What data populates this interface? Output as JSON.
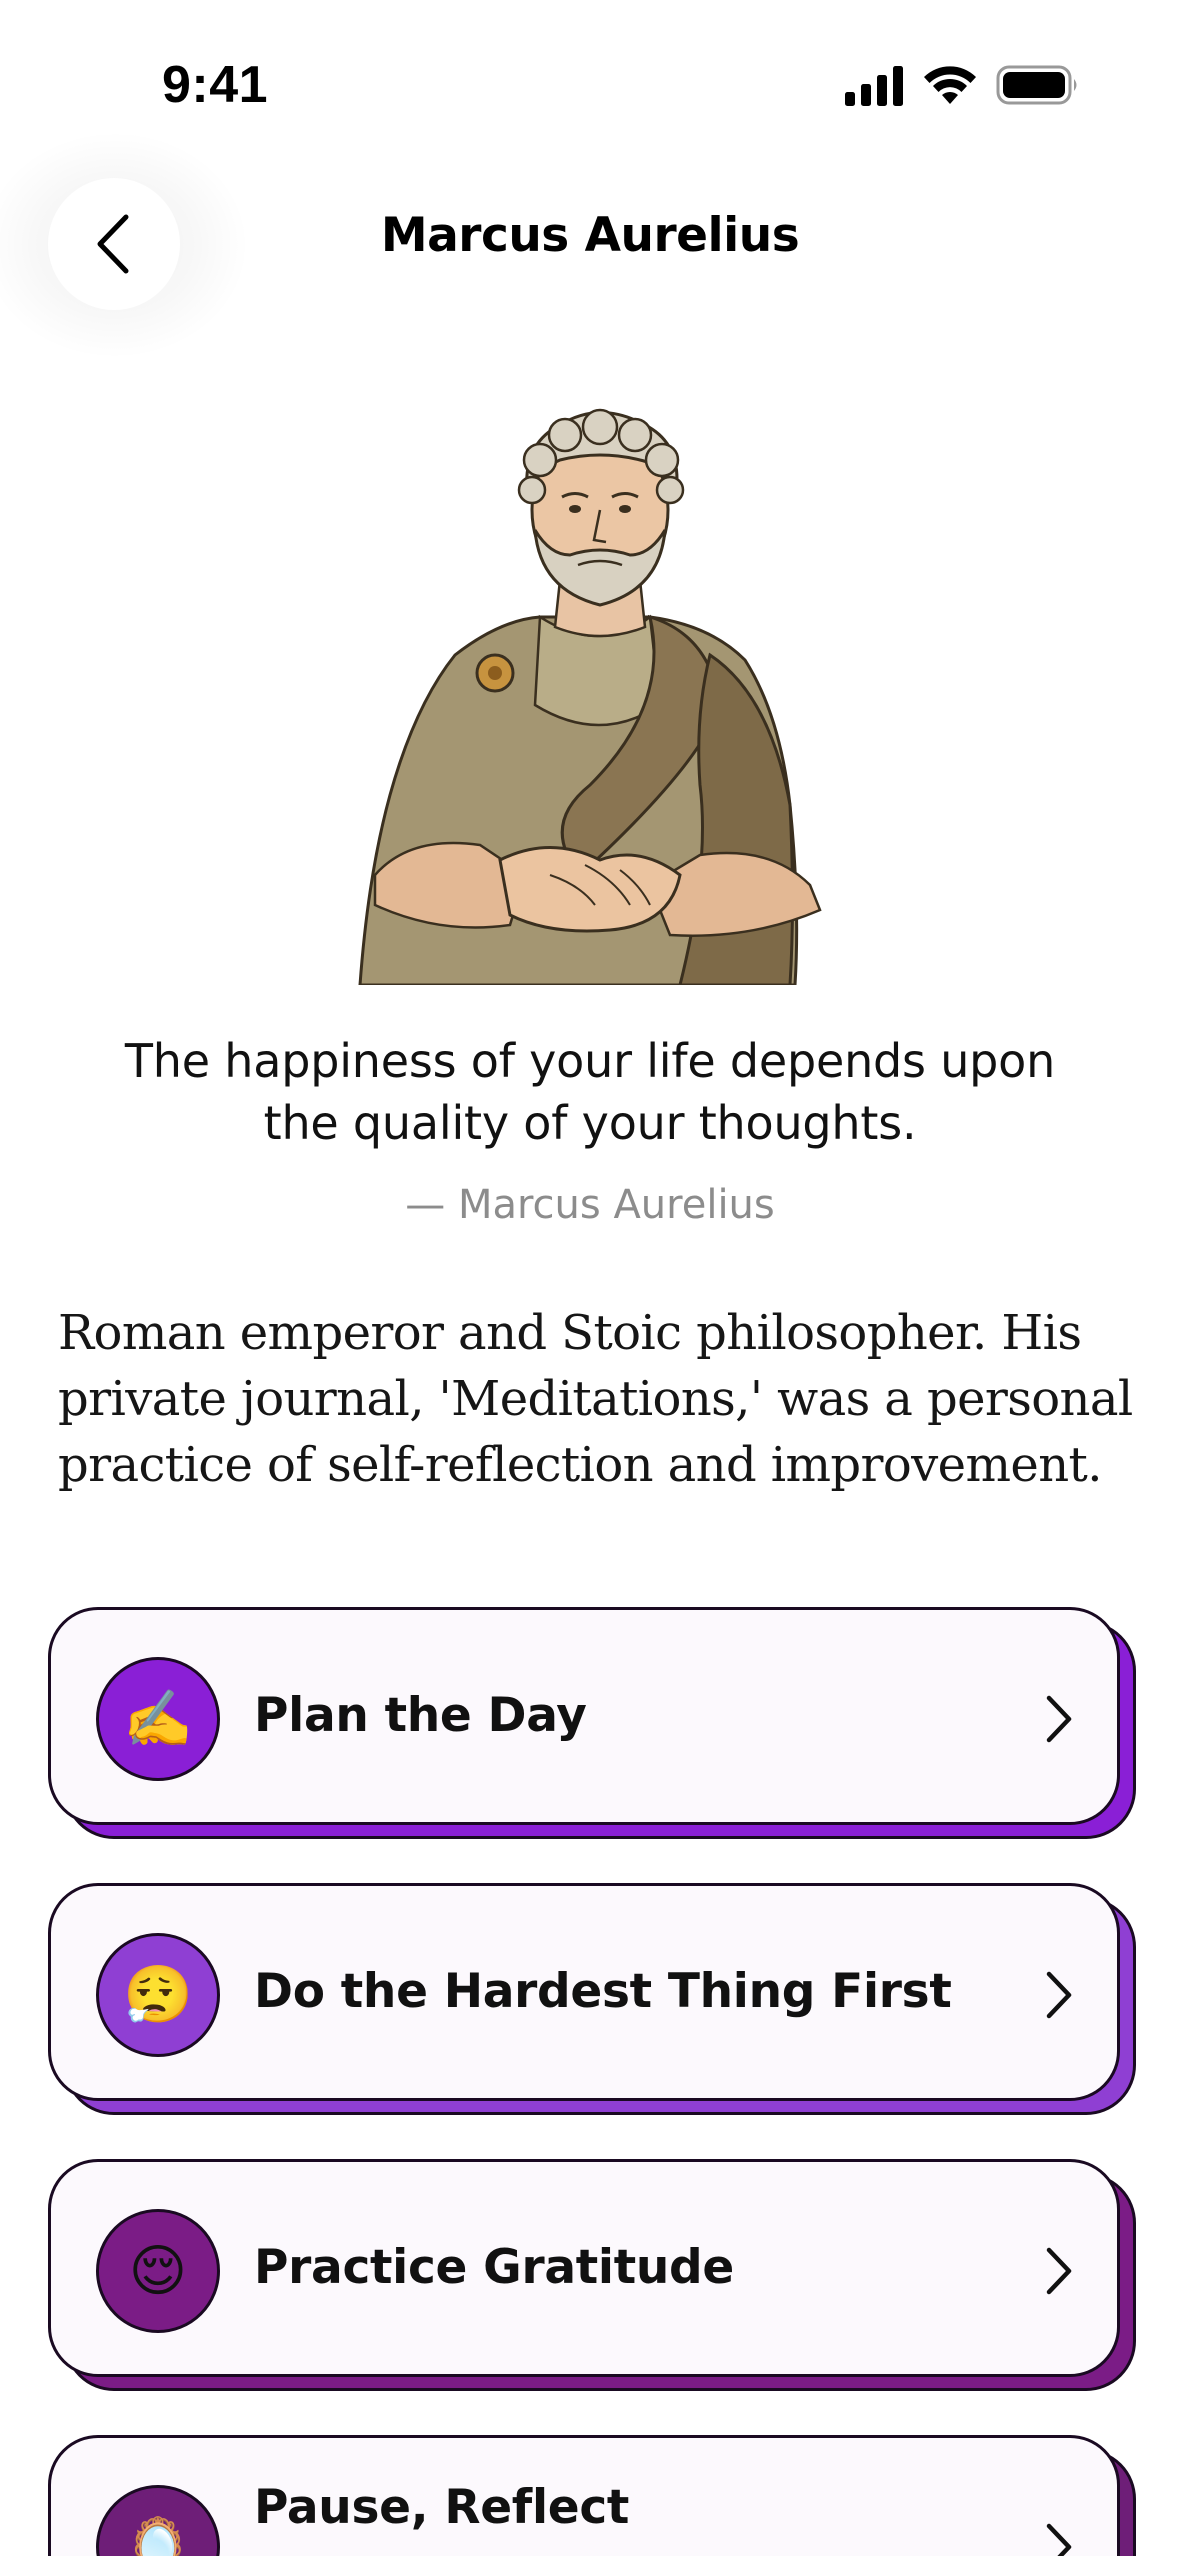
{
  "status_bar": {
    "time": "9:41"
  },
  "header": {
    "title": "Marcus Aurelius",
    "back_icon": "chevron-left-icon"
  },
  "portrait": {
    "subject": "marcus-aurelius-illustration"
  },
  "quote": {
    "text": "The happiness of your life depends upon the quality of your thoughts.",
    "author": "— Marcus Aurelius"
  },
  "bio": "Roman emperor and Stoic philosopher. His private journal, 'Meditations,' was a personal practice of self-reflection and improvement.",
  "practices": [
    {
      "label": "Plan the Day",
      "icon": "✍️",
      "color": "#8a1fd6"
    },
    {
      "label": "Do the Hardest Thing First",
      "icon": "😮‍💨",
      "color": "#8f3fd3"
    },
    {
      "label": "Practice Gratitude",
      "icon": "😌",
      "color": "#7b1c86"
    },
    {
      "label": "Pause, Reflect",
      "icon": "🪞",
      "color": "#6e1e78"
    }
  ],
  "colors": {
    "card_background": "#fcf9fd",
    "card_outline": "#1a0a22",
    "muted_text": "#8c8c8c"
  }
}
